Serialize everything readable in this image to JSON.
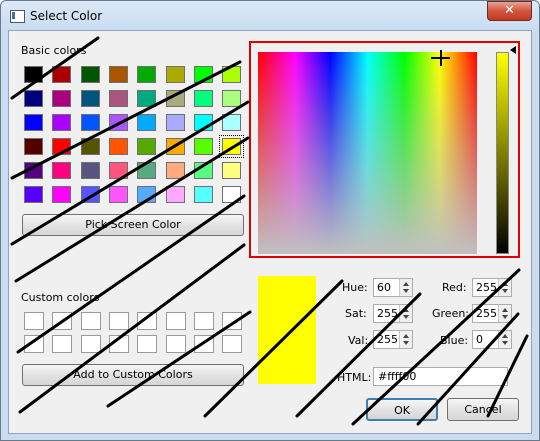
{
  "window": {
    "title": "Select Color",
    "close_glyph": "✕"
  },
  "basic_colors": {
    "label": "Basic colors",
    "swatches": [
      "#000000",
      "#aa0000",
      "#005500",
      "#aa5500",
      "#00aa00",
      "#aaaa00",
      "#00ff00",
      "#aaff00",
      "#00007f",
      "#aa007f",
      "#00557f",
      "#aa557f",
      "#00aa7f",
      "#aaaa7f",
      "#00ff7f",
      "#aaff7f",
      "#0000ff",
      "#aa00ff",
      "#0055ff",
      "#aa55ff",
      "#00aaff",
      "#aaaaff",
      "#00ffff",
      "#aaffff",
      "#550000",
      "#ff0000",
      "#555500",
      "#ff5500",
      "#55aa00",
      "#ffaa00",
      "#55ff00",
      "#ffff00",
      "#55007f",
      "#ff007f",
      "#55557f",
      "#ff557f",
      "#55aa7f",
      "#ffaa7f",
      "#55ff7f",
      "#ffff7f",
      "#5500ff",
      "#ff00ff",
      "#5555ff",
      "#ff55ff",
      "#55aaff",
      "#ffaaff",
      "#55ffff",
      "#ffffff"
    ],
    "selected_index": 31
  },
  "buttons": {
    "pick_screen_color": "Pick Screen Color",
    "add_to_custom_colors": "Add to Custom Colors",
    "ok": "OK",
    "cancel": "Cancel"
  },
  "custom_colors": {
    "label": "Custom colors",
    "count": 16
  },
  "fields": {
    "hue": {
      "label": "Hue:",
      "value": "60"
    },
    "sat": {
      "label": "Sat:",
      "value": "255"
    },
    "val": {
      "label": "Val:",
      "value": "255"
    },
    "red": {
      "label": "Red:",
      "value": "255"
    },
    "green": {
      "label": "Green:",
      "value": "255"
    },
    "blue": {
      "label": "Blue:",
      "value": "0"
    },
    "html": {
      "label": "HTML:",
      "value": "#ffff00"
    }
  },
  "current_color": "#ffff00",
  "accent": {
    "highlight_frame": "#e00000",
    "scribble": "#000000"
  }
}
